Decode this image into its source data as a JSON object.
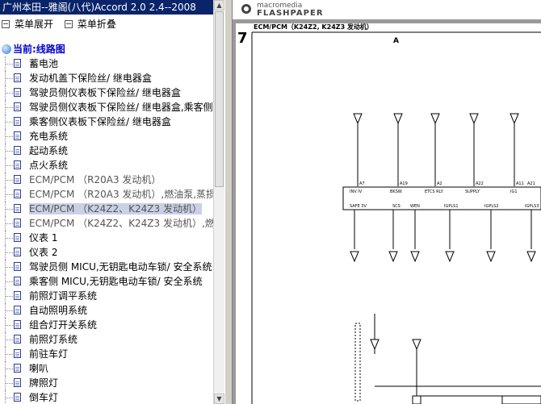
{
  "window": {
    "title": "广州本田--雅阁(八代)Accord 2.0 2.4--2008"
  },
  "toolbar": {
    "expand": "菜单展开",
    "collapse": "菜单折叠"
  },
  "tree": {
    "root": "当前:线路图",
    "items": [
      "蓄电池",
      "发动机盖下保险丝/ 继电器盒",
      "驾驶员侧仪表板下保险丝/ 继电器盒",
      "驾驶员侧仪表板下保险丝/ 继电器盒,乘客侧",
      "乘客侧仪表板下保险丝/ 继电器盒",
      "充电系统",
      "起动系统",
      "点火系统",
      "ECM/PCM （R20A3 发动机）",
      "ECM/PCM （R20A3 发动机）,燃油泵,蒸损",
      "ECM/PCM （K24Z2、K24Z3 发动机）",
      "ECM/PCM （K24Z2、K24Z3 发动机）,燃",
      "仪表 1",
      "仪表 2",
      "驾驶员侧 MICU,无钥匙电动车锁/ 安全系统",
      "乘客侧 MICU,无钥匙电动车锁/ 安全系统",
      "前照灯调平系统",
      "自动照明系统",
      "组合灯开关系统",
      "前照灯系统",
      "前驻车灯",
      "喇叭",
      "牌照灯",
      "倒车灯"
    ],
    "selected_index": 10
  },
  "viewer": {
    "brand_small": "macromedia",
    "brand_large": "FLASHPAPER",
    "page_number": "7",
    "page_header": "ECM/PCM（K24Z2, K24Z3 发动机）",
    "column_label": "A",
    "connector_labels": [
      "SAFE 3V",
      "SCS",
      "WEN",
      "IGPLS1",
      "IGPLS2",
      "IGPLS3"
    ],
    "connector_top_labels": [
      "INV IV",
      "BKSW",
      "ETCS RLY",
      "SUPPLY",
      "IG1"
    ],
    "pin_labels": [
      "A7",
      "A19",
      "A2",
      "A22",
      "A11",
      "A21"
    ]
  },
  "colors": {
    "title_bg": "#0a246a",
    "tree_root": "#0000cc",
    "selection": "#c9d1e6",
    "viewer_bg": "#9a9a9a"
  }
}
